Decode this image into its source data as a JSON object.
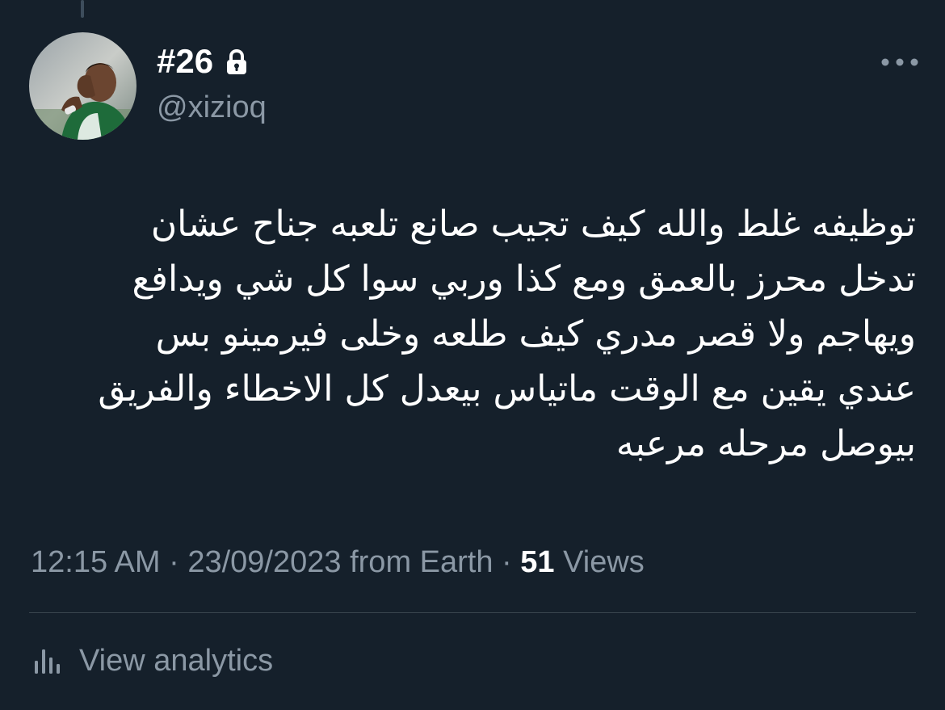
{
  "author": {
    "display_name": "#26",
    "handle": "@xizioq",
    "protected_icon": "lock-icon",
    "avatar_icon": "avatar"
  },
  "menu": {
    "more_icon": "more-horizontal-icon"
  },
  "tweet": {
    "text": "توظيفه غلط والله كيف تجيب صانع تلعبه جناح عشان\nتدخل محرز بالعمق ومع كذا وربي سوا كل شي ويدافع\nويهاجم ولا قصر مدري كيف طلعه وخلى فيرمينو بس\nعندي يقين مع الوقت ماتياس بيعدل كل الاخطاء والفريق\nبيوصل مرحله مرعبه"
  },
  "meta": {
    "time": "12:15 AM",
    "separator": "·",
    "date": "23/09/2023",
    "source": "from Earth",
    "views_count": "51",
    "views_label": "Views"
  },
  "analytics": {
    "icon": "analytics-bars-icon",
    "label": "View analytics"
  },
  "colors": {
    "background": "#15202b",
    "primary_text": "#ffffff",
    "secondary_text": "#8b98a5",
    "divider": "#38444d"
  }
}
